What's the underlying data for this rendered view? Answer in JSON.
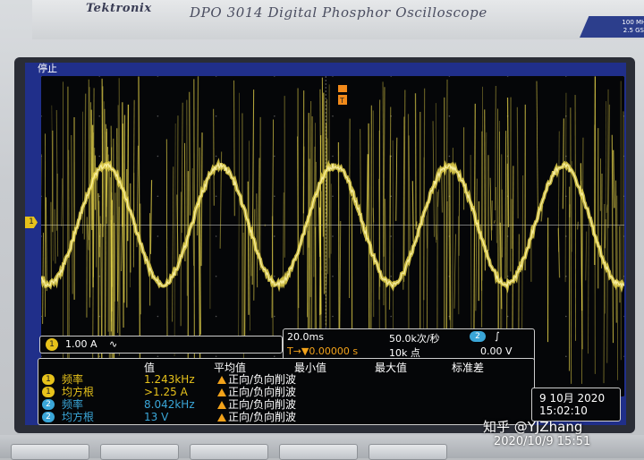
{
  "device": {
    "brand": "Tektronix",
    "model": "DPO 3014 Digital Phosphor Oscilloscope",
    "spec_line1": "100 MHz",
    "spec_line2": "2.5 GS/s"
  },
  "screen": {
    "status": "停止",
    "channel_marker": "1",
    "ch1": {
      "num": "1",
      "scale": "1.00 A",
      "coupling_symbol": "∿"
    },
    "timebase": {
      "time_div": "20.0ms",
      "sample_rate": "50.0k次/秒",
      "trigger_pos": "T→▼0.00000 s",
      "record_length": "10k 点",
      "trig_channel": "2",
      "trig_slope": "∫",
      "trig_level": "0.00 V"
    },
    "measurements": {
      "headers": [
        "值",
        "平均值",
        "最小值",
        "最大值",
        "标准差"
      ],
      "rows": [
        {
          "ch": "1",
          "name": "频率",
          "value": "1.243kHz",
          "mean": "正向/负向削波",
          "color": "#e7c21b"
        },
        {
          "ch": "1",
          "name": "均方根",
          "value": ">1.25 A",
          "mean": "正向/负向削波",
          "color": "#e7c21b"
        },
        {
          "ch": "2",
          "name": "频率",
          "value": "8.042kHz",
          "mean": "正向/负向削波",
          "color": "#3aa6d8"
        },
        {
          "ch": "2",
          "name": "均方根",
          "value": "13 V",
          "mean": "正向/负向削波",
          "color": "#3aa6d8"
        }
      ]
    },
    "date": {
      "date": "9 10月 2020",
      "time": "15:02:10"
    }
  },
  "overlay": {
    "watermark": "知乎 @YJZhang",
    "timestamp": "2020/10/9  15:51"
  },
  "colors": {
    "trace": "#e7d54a",
    "ch2": "#3aa6d8",
    "screen_bg": "#202f8a"
  }
}
